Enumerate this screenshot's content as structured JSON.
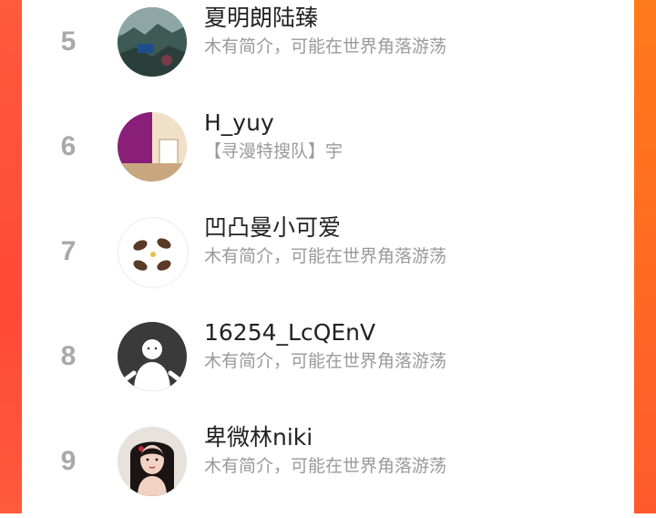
{
  "colors": {
    "left_accent": "#ff4a36",
    "right_accent": "#ff6b22",
    "rank_color": "#a9a9a9",
    "name_color": "#222222",
    "bio_color": "#9a9a9a"
  },
  "ranking": {
    "items": [
      {
        "rank": "5",
        "name": "夏明朗陆臻",
        "bio": "木有简介，可能在世界角落游荡",
        "avatar_icon": "landscape-avatar"
      },
      {
        "rank": "6",
        "name": "H_yuy",
        "bio": "【寻漫特搜队】宇",
        "avatar_icon": "purple-room-avatar"
      },
      {
        "rank": "7",
        "name": "凹凸曼小可爱",
        "bio": "木有简介，可能在世界角落游荡",
        "avatar_icon": "seeds-avatar"
      },
      {
        "rank": "8",
        "name": "16254_LcQEnV",
        "bio": "木有简介，可能在世界角落游荡",
        "avatar_icon": "default-user-avatar"
      },
      {
        "rank": "9",
        "name": "卑微林niki",
        "bio": "木有简介，可能在世界角落游荡",
        "avatar_icon": "portrait-avatar"
      }
    ]
  }
}
